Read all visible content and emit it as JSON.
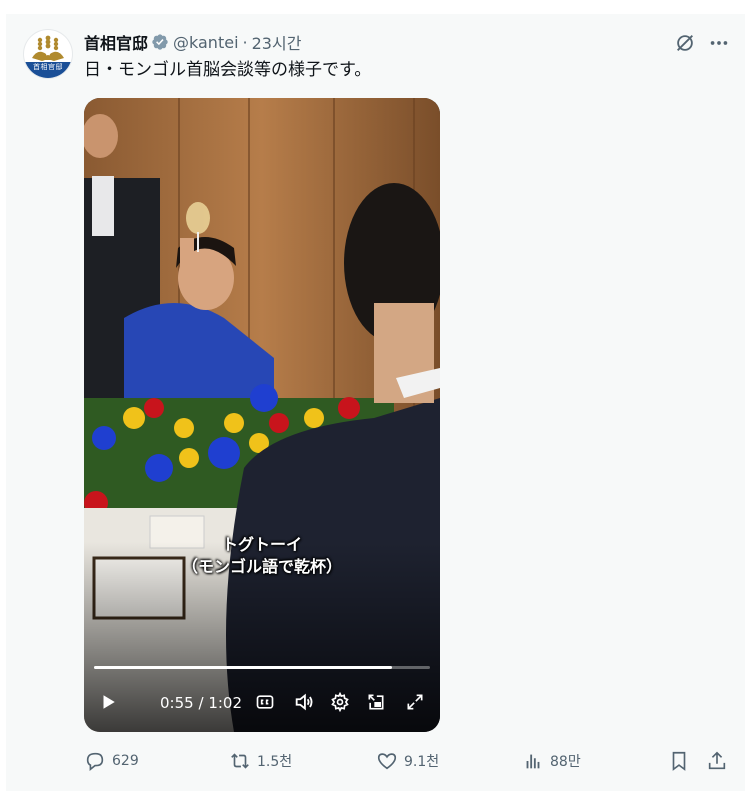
{
  "author": {
    "display_name": "首相官邸",
    "handle": "@kantei",
    "separator": "·",
    "time_ago": "23시간",
    "avatar_text": "首相官邸",
    "verified_color": "#829aab"
  },
  "post": {
    "text": "日・モンゴル首脳会談等の様子です。"
  },
  "video": {
    "caption_line1": "トグトーイ",
    "caption_line2": "（モンゴル語で乾杯）",
    "current_time": "0:55",
    "separator": "/",
    "duration": "1:02",
    "progress_fraction": 0.887
  },
  "actions": {
    "replies": "629",
    "reposts": "1.5천",
    "likes": "9.1천",
    "views": "88만"
  },
  "colors": {
    "text_primary": "#0f1419",
    "text_secondary": "#536471",
    "post_background": "#f7f9f9"
  },
  "icons": {
    "grok": "grok-slash-circle-icon",
    "more": "more-horizontal-icon",
    "reply": "reply-bubble-icon",
    "repost": "repost-arrows-icon",
    "like": "heart-icon",
    "views": "bar-chart-icon",
    "bookmark": "bookmark-icon",
    "share": "share-upload-icon"
  }
}
